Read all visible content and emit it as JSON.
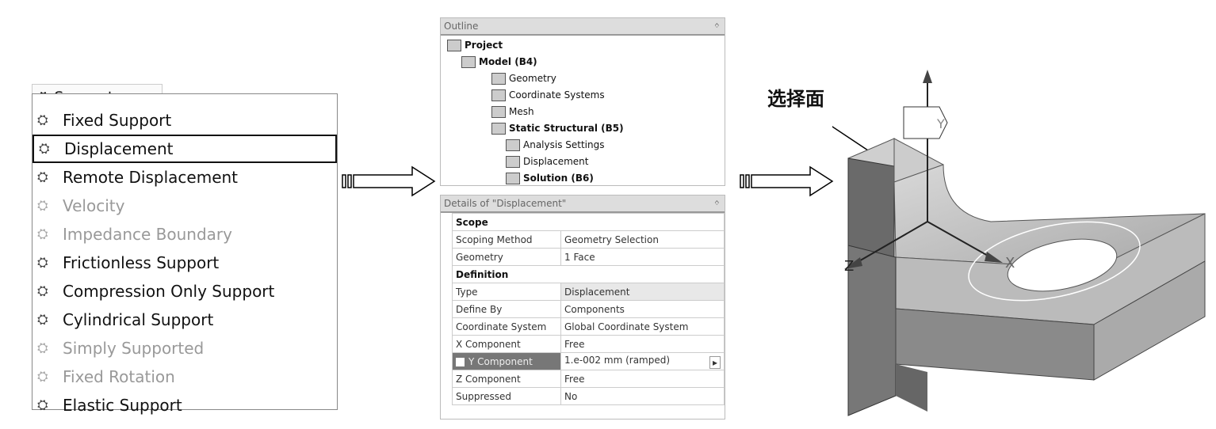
{
  "supports_button": {
    "label": "Supports",
    "icon": "supports-icon",
    "caret": "▼"
  },
  "menu_items": [
    {
      "label": "Fixed Support",
      "enabled": true
    },
    {
      "label": "Displacement",
      "enabled": true,
      "selected": true
    },
    {
      "label": "Remote Displacement",
      "enabled": true
    },
    {
      "label": "Velocity",
      "enabled": false
    },
    {
      "label": "Impedance Boundary",
      "enabled": false
    },
    {
      "label": "Frictionless Support",
      "enabled": true
    },
    {
      "label": "Compression Only Support",
      "enabled": true
    },
    {
      "label": "Cylindrical Support",
      "enabled": true
    },
    {
      "label": "Simply Supported",
      "enabled": false
    },
    {
      "label": "Fixed Rotation",
      "enabled": false
    },
    {
      "label": "Elastic Support",
      "enabled": true
    }
  ],
  "outline": {
    "title": "Outline",
    "pin": "ᛜ",
    "tree": [
      {
        "label": "Project",
        "bold": true,
        "level": 0
      },
      {
        "label": "Model (B4)",
        "bold": true,
        "level": 1
      },
      {
        "label": "Geometry",
        "bold": false,
        "level": 2
      },
      {
        "label": "Coordinate Systems",
        "bold": false,
        "level": 2
      },
      {
        "label": "Mesh",
        "bold": false,
        "level": 2
      },
      {
        "label": "Static Structural (B5)",
        "bold": true,
        "level": 2
      },
      {
        "label": "Analysis Settings",
        "bold": false,
        "level": 3
      },
      {
        "label": "Displacement",
        "bold": false,
        "level": 3
      },
      {
        "label": "Solution (B6)",
        "bold": true,
        "level": 3
      }
    ]
  },
  "details": {
    "title": "Details of \"Displacement\"",
    "pin": "ᛜ",
    "rows": [
      {
        "group": "Scope"
      },
      {
        "k": "Scoping Method",
        "v": "Geometry Selection"
      },
      {
        "k": "Geometry",
        "v": "1 Face"
      },
      {
        "group": "Definition"
      },
      {
        "k": "Type",
        "v": "Displacement"
      },
      {
        "k": "Define By",
        "v": "Components"
      },
      {
        "k": "Coordinate System",
        "v": "Global Coordinate System"
      },
      {
        "k": "X Component",
        "v": "Free"
      },
      {
        "k": "Y Component",
        "v": "1.e-002 mm  (ramped)"
      },
      {
        "k": "Z Component",
        "v": "Free"
      },
      {
        "k": "Suppressed",
        "v": "No"
      }
    ]
  },
  "annotation": "选择面",
  "axes": {
    "y": "Y",
    "x": "X",
    "z": "Z"
  }
}
